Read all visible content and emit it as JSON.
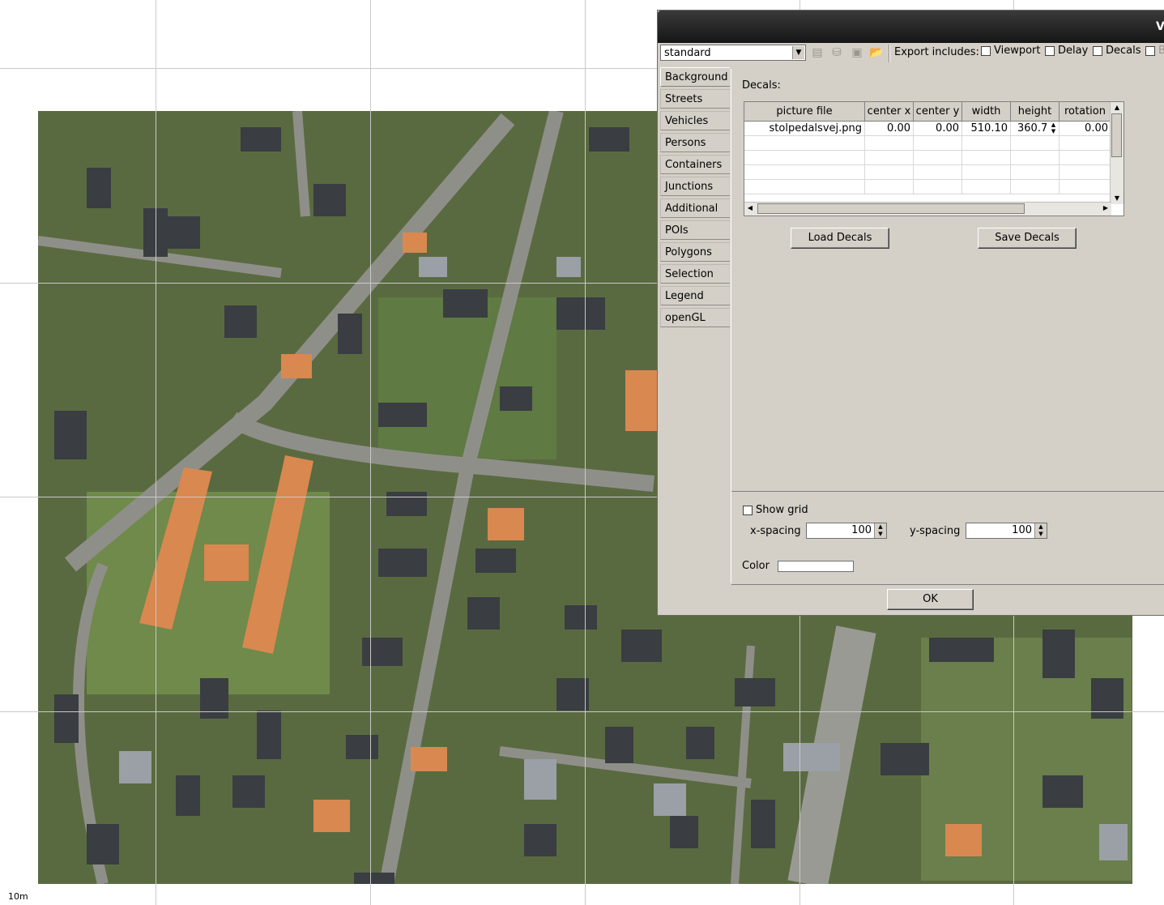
{
  "canvas": {
    "scale_label": "10m"
  },
  "dialog": {
    "title_fragment": "V",
    "scheme": {
      "selected": "standard"
    },
    "toolbar": {
      "icons": [
        "new-scheme-icon",
        "save-scheme-db-icon",
        "save-settings-icon",
        "open-settings-icon"
      ],
      "export_label": "Export includes:",
      "export_options": [
        {
          "label": "Viewport",
          "checked": false
        },
        {
          "label": "Delay",
          "checked": false
        },
        {
          "label": "Decals",
          "checked": false
        },
        {
          "label": "B",
          "checked": false
        }
      ]
    },
    "tabs": [
      "Background",
      "Streets",
      "Vehicles",
      "Persons",
      "Containers",
      "Junctions",
      "Additional",
      "POIs",
      "Polygons",
      "Selection",
      "Legend",
      "openGL"
    ],
    "active_tab": "Background",
    "decals": {
      "title": "Decals:",
      "columns": [
        "picture file",
        "center x",
        "center y",
        "width",
        "height",
        "rotation"
      ],
      "rows": [
        {
          "picture_file": "stolpedalsvej.png",
          "center_x": "0.00",
          "center_y": "0.00",
          "width": "510.10",
          "height": "360.7",
          "rotation": "0.00"
        }
      ],
      "load_button": "Load Decals",
      "save_button": "Save Decals"
    },
    "grid": {
      "show_grid_label": "Show grid",
      "show_grid_checked": false,
      "x_spacing_label": "x-spacing",
      "x_spacing_value": "100",
      "y_spacing_label": "y-spacing",
      "y_spacing_value": "100",
      "color_label": "Color",
      "color_value": "#ffffff"
    },
    "ok_button": "OK"
  }
}
